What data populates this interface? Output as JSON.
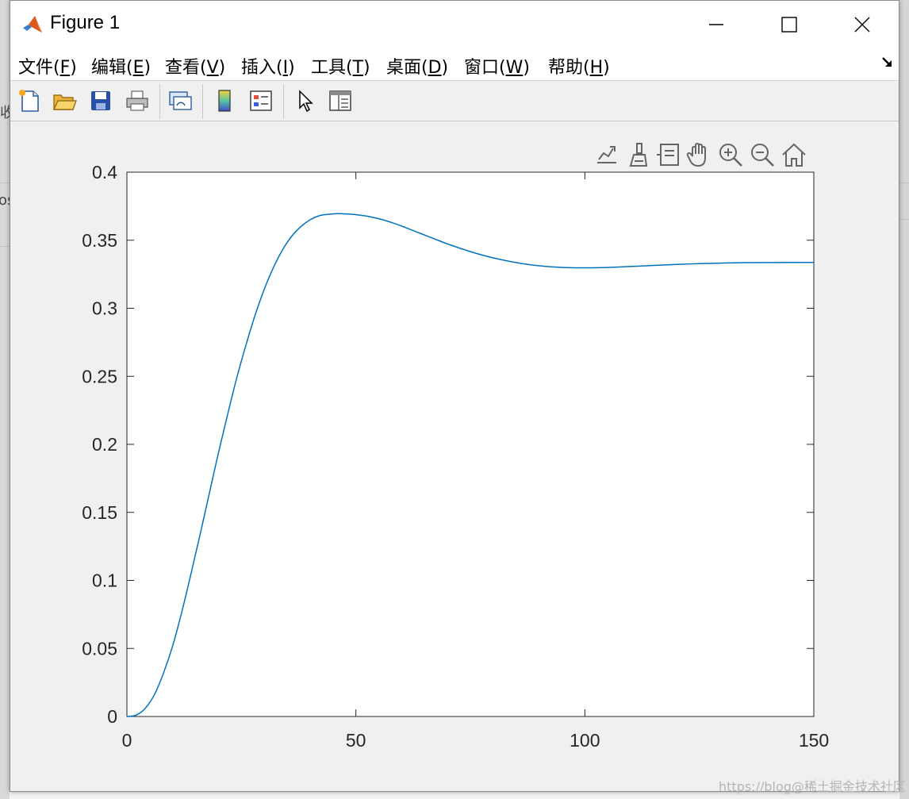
{
  "window": {
    "title": "Figure 1",
    "icons": {
      "app": "matlab-logo-icon",
      "minimize": "minimize-icon",
      "maximize": "maximize-icon",
      "close": "close-icon"
    }
  },
  "background": {
    "left_fragment_1": "收",
    "left_fragment_2": "os"
  },
  "menu": {
    "items": [
      {
        "label": "文件(",
        "key": "F",
        "tail": ")"
      },
      {
        "label": "编辑(",
        "key": "E",
        "tail": ")"
      },
      {
        "label": "查看(",
        "key": "V",
        "tail": ")"
      },
      {
        "label": "插入(",
        "key": "I",
        "tail": ")"
      },
      {
        "label": "工具(",
        "key": "T",
        "tail": ")"
      },
      {
        "label": "桌面(",
        "key": "D",
        "tail": ")"
      },
      {
        "label": "窗口(",
        "key": "W",
        "tail": ")"
      },
      {
        "label": "帮助(",
        "key": "H",
        "tail": ")"
      }
    ],
    "dock_icon": "dock-arrow-icon"
  },
  "toolbar": {
    "buttons": [
      "new-figure-icon",
      "open-file-icon",
      "save-icon",
      "print-icon",
      "link-plot-icon",
      "colorbar-icon",
      "legend-icon",
      "edit-plot-arrow-icon",
      "property-inspector-icon"
    ]
  },
  "axes_toolbar": {
    "buttons": [
      "export-icon",
      "brush-icon",
      "data-tips-icon",
      "pan-icon",
      "zoom-in-icon",
      "zoom-out-icon",
      "home-icon"
    ]
  },
  "chart_data": {
    "type": "line",
    "xlim": [
      0,
      150
    ],
    "ylim": [
      0,
      0.4
    ],
    "xticks": [
      0,
      50,
      100,
      150
    ],
    "yticks": [
      0,
      0.05,
      0.1,
      0.15,
      0.2,
      0.25,
      0.3,
      0.35,
      0.4
    ],
    "xtick_labels": [
      "0",
      "50",
      "100",
      "150"
    ],
    "ytick_labels": [
      "0",
      "0.05",
      "0.1",
      "0.15",
      "0.2",
      "0.25",
      "0.3",
      "0.35",
      "0.4"
    ],
    "grid": false,
    "series_color": "#0072BD",
    "series": [
      {
        "x": [
          0,
          2,
          4,
          6,
          8,
          10,
          12,
          14,
          16,
          18,
          20,
          22,
          24,
          26,
          28,
          30,
          32,
          34,
          36,
          38,
          40,
          42,
          44,
          46,
          48,
          50,
          52,
          55,
          58,
          61,
          64,
          67,
          70,
          73,
          76,
          80,
          84,
          88,
          92,
          96,
          100,
          104,
          108,
          112,
          116,
          120,
          125,
          130,
          135,
          140,
          145,
          150
        ],
        "y": [
          0,
          0.001,
          0.006,
          0.016,
          0.032,
          0.052,
          0.077,
          0.105,
          0.134,
          0.164,
          0.194,
          0.222,
          0.249,
          0.273,
          0.295,
          0.314,
          0.33,
          0.343,
          0.353,
          0.36,
          0.365,
          0.368,
          0.369,
          0.3695,
          0.3693,
          0.3688,
          0.3679,
          0.3658,
          0.3628,
          0.3591,
          0.3551,
          0.3512,
          0.3473,
          0.3438,
          0.3406,
          0.337,
          0.3342,
          0.332,
          0.3306,
          0.3299,
          0.3297,
          0.3299,
          0.3304,
          0.331,
          0.3316,
          0.3322,
          0.3328,
          0.3332,
          0.3335,
          0.3336,
          0.3337,
          0.3337
        ]
      }
    ]
  },
  "watermark": "https://blog@稀土掘金技术社区"
}
